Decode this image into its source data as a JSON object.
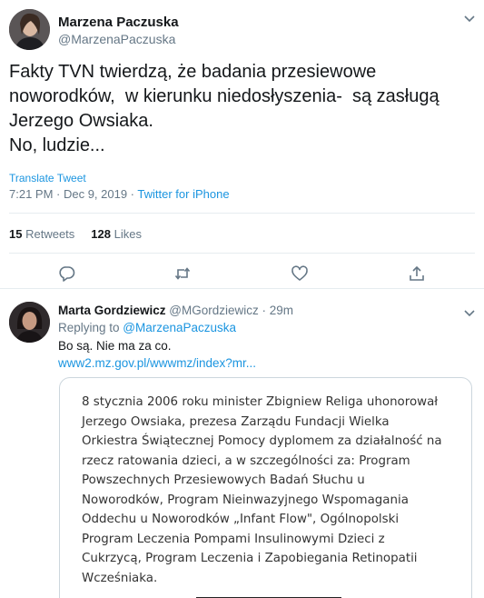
{
  "tweet": {
    "author_name": "Marzena Paczuska",
    "author_handle": "@MarzenaPaczuska",
    "text_lines": [
      "Fakty TVN twierdzą, że badania przesiewowe",
      "noworodków,  w kierunku niedosłyszenia-  są zasługą",
      "Jerzego Owsiaka.",
      "No, ludzie..."
    ],
    "translate_label": "Translate Tweet",
    "timestamp": "7:21 PM · Dec 9, 2019 · ",
    "source": "Twitter for iPhone",
    "retweets_count": "15",
    "retweets_label": "Retweets",
    "likes_count": "128",
    "likes_label": "Likes",
    "action_icons": [
      "reply-icon",
      "retweet-icon",
      "like-icon",
      "share-icon"
    ]
  },
  "reply": {
    "author_name": "Marta Gordziewicz",
    "author_handle": "@MGordziewicz",
    "time": "· 29m",
    "replying_prefix": "Replying to ",
    "replying_to": "@MarzenaPaczuska",
    "text": "Bo są. Nie ma za co.",
    "link": "www2.mz.gov.pl/wwwmz/index?mr...",
    "card_lines": [
      "8 stycznia 2006 roku minister Zbigniew Religa uhonorował",
      "Jerzego Owsiaka, prezesa Zarządu Fundacji Wielka",
      "Orkiestra Świątecznej Pomocy dyplomem za działalność na",
      "rzecz ratowania dzieci, a w szczególności za: Program",
      "Powszechnych Przesiewowych Badań Słuchu u",
      "Noworodków, Program Nieinwazyjnego Wspomagania",
      "Oddechu u Noworodków „Infant Flow\", Ogólnopolski",
      "Program Leczenia Pompami Insulinowymi Dzieci z",
      "Cukrzycą, Program Leczenia i Zapobiegania Retinopatii",
      "Wcześniaka."
    ]
  },
  "colors": {
    "link": "#1b95e0",
    "secondary_text": "#657786",
    "divider": "#e6ecf0"
  }
}
